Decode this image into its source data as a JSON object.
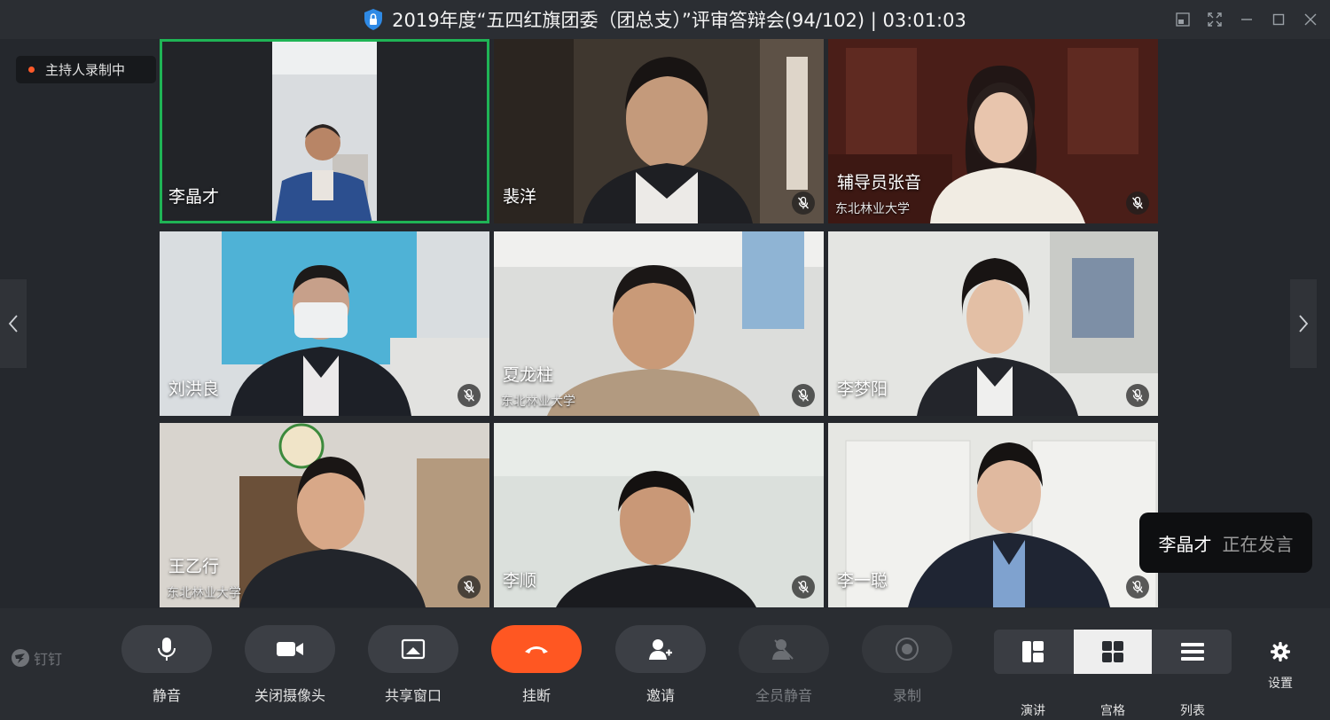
{
  "window": {
    "title": "2019年度“五四红旗团委（团总支）”评审答辩会(94/102) | 03:01:03",
    "controls": [
      "picture-in-picture-icon",
      "fullscreen-icon",
      "minimize-icon",
      "maximize-icon",
      "close-icon"
    ]
  },
  "recording_badge": {
    "text": "主持人录制中",
    "dot_color": "#ff5a2a"
  },
  "participants": [
    {
      "name": "李晶才",
      "org": "",
      "muted": false,
      "active_speaker": true
    },
    {
      "name": "裴洋",
      "org": "",
      "muted": true,
      "active_speaker": false
    },
    {
      "name": "辅导员张音",
      "org": "东北林业大学",
      "muted": true,
      "active_speaker": false
    },
    {
      "name": "刘洪良",
      "org": "",
      "muted": true,
      "active_speaker": false
    },
    {
      "name": "夏龙柱",
      "org": "东北林业大学",
      "muted": true,
      "active_speaker": false
    },
    {
      "name": "李梦阳",
      "org": "",
      "muted": true,
      "active_speaker": false
    },
    {
      "name": "王乙行",
      "org": "东北林业大学",
      "muted": true,
      "active_speaker": false
    },
    {
      "name": "李顺",
      "org": "",
      "muted": true,
      "active_speaker": false
    },
    {
      "name": "李一聪",
      "org": "",
      "muted": true,
      "active_speaker": false
    }
  ],
  "speaking_toast": {
    "name": "李晶才",
    "status": "正在发言"
  },
  "toolbar": {
    "brand": "钉钉",
    "mute": "静音",
    "camera_off": "关闭摄像头",
    "share_window": "共享窗口",
    "hang_up": "挂断",
    "invite": "邀请",
    "mute_all": "全员静音",
    "record": "录制",
    "layout_speaker": "演讲",
    "layout_grid": "宫格",
    "layout_list": "列表",
    "settings": "设置"
  },
  "colors": {
    "accent_green": "#1fb455",
    "hangup_red": "#ff5722",
    "background": "#25282d"
  }
}
